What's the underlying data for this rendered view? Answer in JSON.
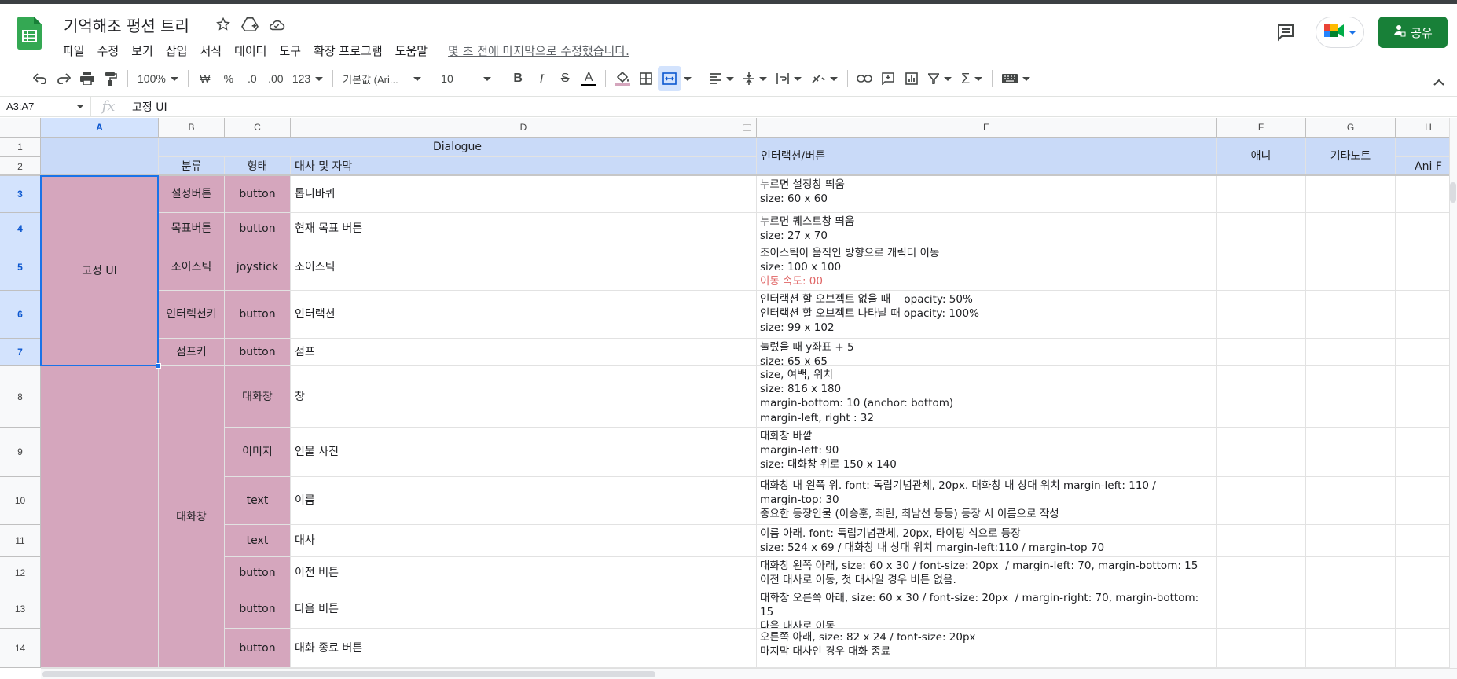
{
  "app": {
    "title": "기억해조 펑션 트리",
    "last_edit": "몇 초 전에 마지막으로 수정했습니다.",
    "share_label": "공유",
    "brand_green": "#188038",
    "menu": [
      "파일",
      "수정",
      "보기",
      "삽입",
      "서식",
      "데이터",
      "도구",
      "확장 프로그램",
      "도움말"
    ]
  },
  "toolbar": {
    "zoom": "100%",
    "currency": "₩",
    "percent": "%",
    "dec_less": ".0",
    "dec_more": ".00",
    "number_format": "123",
    "font": "기본값 (Ari...",
    "font_size": "10",
    "bold": "B",
    "italic": "I",
    "strike": "S",
    "text_color": "A"
  },
  "formula": {
    "name_box": "A3:A7",
    "fx": "fx",
    "value": "고정 UI"
  },
  "grid": {
    "columns": [
      "A",
      "B",
      "C",
      "D",
      "E",
      "F",
      "G",
      "H"
    ],
    "rows": [
      "1",
      "2",
      "3",
      "4",
      "5",
      "6",
      "7",
      "8",
      "9",
      "10",
      "11",
      "12",
      "13",
      "14"
    ],
    "header": {
      "dialogue": "Dialogue",
      "category": "분류",
      "form": "형태",
      "lines": "대사 및 자막",
      "interaction": "인터랙션/버튼",
      "anim": "애니",
      "notes": "기타노트",
      "ani_f": "Ani F"
    },
    "merged": {
      "fixed_ui": "고정 UI",
      "dialog_box": "대화창"
    },
    "body": [
      {
        "b": "설정버튼",
        "c": "button",
        "d": "톱니바퀴",
        "e": [
          "누르면 설정창 띄움",
          "size: 60 x 60"
        ]
      },
      {
        "b": "목표버튼",
        "c": "button",
        "d": "현재 목표 버튼",
        "e": [
          "누르면 퀘스트창 띄움",
          "size: 27 x 70"
        ]
      },
      {
        "b": "조이스틱",
        "c": "joystick",
        "d": "조이스틱",
        "e": [
          "조이스틱이 움직인 방향으로 캐릭터 이동",
          "size: 100 x 100"
        ],
        "e_red": "이동 속도: 00"
      },
      {
        "b": "인터렉션키",
        "c": "button",
        "d": "인터랙션",
        "e": [
          "인터랙션 할 오브젝트 없을 때    opacity: 50%",
          "인터랙션 할 오브젝트 나타날 때 opacity: 100%",
          "size: 99 x 102"
        ]
      },
      {
        "b": "점프키",
        "c": "button",
        "d": "점프",
        "e": [
          "눌렀을 때 y좌표 + 5",
          "size: 65 x 65"
        ]
      },
      {
        "c": "대화창",
        "d": "창",
        "e": [
          "size, 여백, 위치",
          "size: 816 x 180",
          "margin-bottom: 10 (anchor: bottom)",
          "margin-left, right : 32"
        ]
      },
      {
        "c": "이미지",
        "d": "인물 사진",
        "e": [
          "대화창 바깥",
          "margin-left: 90",
          "size: 대화창 위로 150 x 140"
        ]
      },
      {
        "c": "text",
        "d": "이름",
        "e": [
          "대화창 내 왼쪽 위. font: 독립기념관체, 20px. 대화창 내 상대 위치 margin-left: 110 /",
          "margin-top: 30",
          "중요한 등장인물 (이승훈, 최린, 최남선 등등) 등장 시 이름으로 작성"
        ]
      },
      {
        "c": "text",
        "d": "대사",
        "e": [
          "이름 아래. font: 독립기념관체, 20px, 타이핑 식으로 등장",
          "size: 524 x 69 / 대화창 내 상대 위치 margin-left:110 / margin-top 70"
        ]
      },
      {
        "c": "button",
        "d": "이전 버튼",
        "e": [
          "대화창 왼쪽 아래, size: 60 x 30 / font-size: 20px  / margin-left: 70, margin-bottom: 15",
          "이전 대사로 이동, 첫 대사일 경우 버튼 없음."
        ]
      },
      {
        "c": "button",
        "d": "다음 버튼",
        "e": [
          "대화창 오른쪽 아래, size: 60 x 30 / font-size: 20px  / margin-right: 70, margin-bottom:",
          "15",
          "다음 대사로 이동"
        ]
      },
      {
        "c": "button",
        "d": "대화 종료 버튼",
        "e": [
          "오른쪽 아래, size: 82 x 24 / font-size: 20px",
          "마지막 대사인 경우 대화 종료"
        ]
      }
    ]
  }
}
